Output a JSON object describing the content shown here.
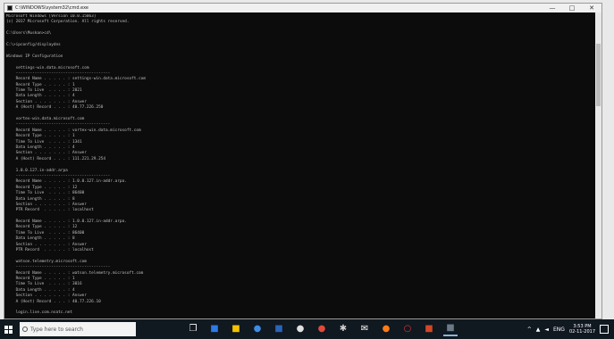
{
  "window": {
    "title": "C:\\WINDOWS\\system32\\cmd.exe",
    "controls": {
      "minimize": "—",
      "maximize": "□",
      "close": "✕"
    }
  },
  "console_lines": [
    "Microsoft Windows [Version 10.0.15063]",
    "(c) 2017 Microsoft Corporation. All rights reserved.",
    "",
    "C:\\Users\\Muskan>cd\\",
    "",
    "C:\\>ipconfig/displaydns",
    "",
    "Windows IP Configuration",
    "",
    "    settings-win.data.microsoft.com",
    "    ----------------------------------------",
    "    Record Name . . . . . : settings-win.data.microsoft.com",
    "    Record Type . . . . . : 1",
    "    Time To Live  . . . . : 2021",
    "    Data Length . . . . . : 4",
    "    Section . . . . . . . : Answer",
    "    A (Host) Record . . . : 40.77.226.250",
    "",
    "    vortex-win.data.microsoft.com",
    "    ----------------------------------------",
    "    Record Name . . . . . : vortex-win.data.microsoft.com",
    "    Record Type . . . . . : 1",
    "    Time To Live  . . . . : 1341",
    "    Data Length . . . . . : 4",
    "    Section . . . . . . . : Answer",
    "    A (Host) Record . . . : 111.221.29.254",
    "",
    "    1.0.0.127.in-addr.arpa",
    "    ----------------------------------------",
    "    Record Name . . . . . : 1.0.0.127.in-addr.arpa.",
    "    Record Type . . . . . : 12",
    "    Time To Live  . . . . : 86400",
    "    Data Length . . . . . : 8",
    "    Section . . . . . . . : Answer",
    "    PTR Record  . . . . . : localhost",
    "",
    "    Record Name . . . . . : 1.0.0.127.in-addr.arpa.",
    "    Record Type . . . . . : 12",
    "    Time To Live  . . . . : 86400",
    "    Data Length . . . . . : 8",
    "    Section . . . . . . . : Answer",
    "    PTR Record  . . . . . : localhost",
    "",
    "    watson.telemetry.microsoft.com",
    "    ----------------------------------------",
    "    Record Name . . . . . : watson.telemetry.microsoft.com",
    "    Record Type . . . . . : 1",
    "    Time To Live  . . . . : 3016",
    "    Data Length . . . . . : 4",
    "    Section . . . . . . . : Answer",
    "    A (Host) Record . . . : 40.77.226.10",
    "",
    "    login.live.com.nsatc.net"
  ],
  "taskbar": {
    "search_placeholder": "Type here to search",
    "apps": [
      {
        "name": "task-view",
        "glyph": "❐",
        "color": "#ffffff"
      },
      {
        "name": "store",
        "glyph": "■",
        "color": "#2d7be5"
      },
      {
        "name": "file-explorer",
        "glyph": "■",
        "color": "#f2c200"
      },
      {
        "name": "edge",
        "glyph": "●",
        "color": "#3c8de6"
      },
      {
        "name": "word",
        "glyph": "■",
        "color": "#2b64b8"
      },
      {
        "name": "media",
        "glyph": "●",
        "color": "#e0e0e0"
      },
      {
        "name": "chrome",
        "glyph": "●",
        "color": "#e04a3a"
      },
      {
        "name": "settings",
        "glyph": "✱",
        "color": "#d0d0d0"
      },
      {
        "name": "mail",
        "glyph": "✉",
        "color": "#ffffff"
      },
      {
        "name": "firefox",
        "glyph": "●",
        "color": "#ff7a18"
      },
      {
        "name": "opera",
        "glyph": "○",
        "color": "#e33"
      },
      {
        "name": "powerpoint",
        "glyph": "■",
        "color": "#d24726"
      },
      {
        "name": "cmd",
        "glyph": "■",
        "color": "#6b7a86"
      }
    ],
    "tray": {
      "language": "ENG",
      "time": "3:53 PM",
      "date": "02-11-2017"
    }
  }
}
